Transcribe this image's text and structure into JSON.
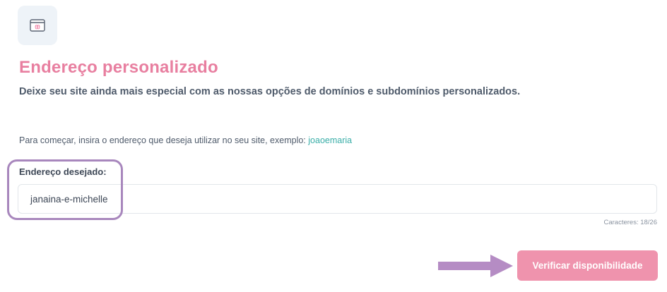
{
  "header": {
    "icon": "browser-globe-icon",
    "title": "Endereço personalizado",
    "subtitle": "Deixe seu site ainda mais especial com as nossas opções de domínios e subdomínios personalizados."
  },
  "instruction": {
    "text": "Para começar, insira o endereço que deseja utilizar no seu site, exemplo: ",
    "example": "joaoemaria"
  },
  "form": {
    "label": "Endereço desejado:",
    "value": "janaina-e-michelle",
    "char_count": "Caracteres: 18/26"
  },
  "actions": {
    "verify_label": "Verificar disponibilidade"
  },
  "colors": {
    "accent_pink": "#e87fa0",
    "button_pink": "#ef93ad",
    "link_teal": "#3aaea8",
    "highlight_purple": "#a887bd"
  }
}
